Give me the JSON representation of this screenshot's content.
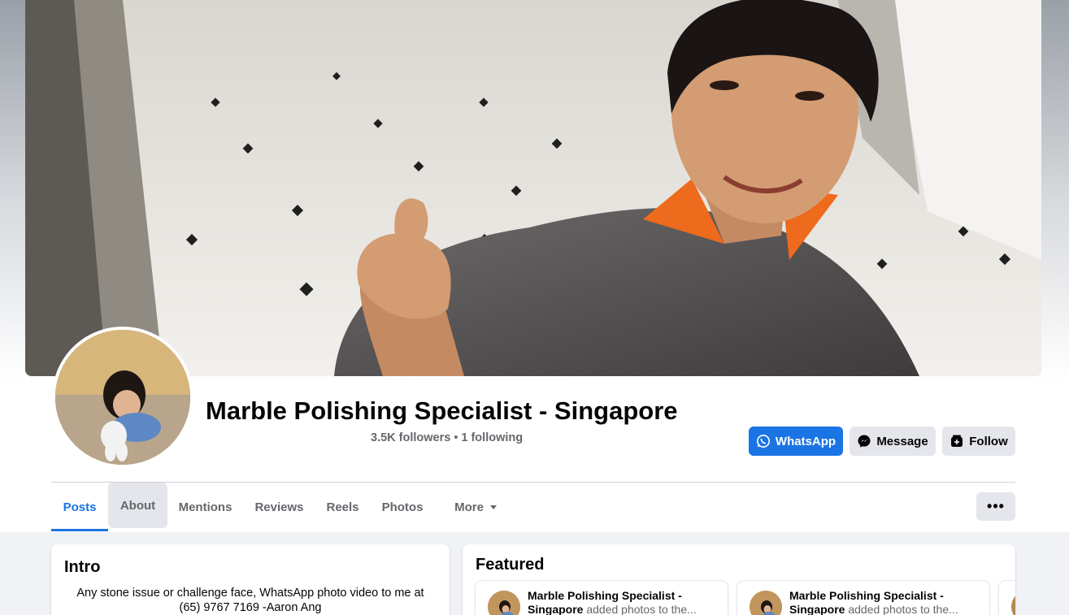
{
  "page": {
    "name": "Marble Polishing Specialist - Singapore",
    "followers": "3.5K followers",
    "separator": "•",
    "following": "1 following"
  },
  "actions": {
    "whatsapp_label": "WhatsApp",
    "message_label": "Message",
    "follow_label": "Follow",
    "more_options_label": "•••"
  },
  "tabs": [
    {
      "label": "Posts",
      "active": true
    },
    {
      "label": "About",
      "active": false
    },
    {
      "label": "Mentions",
      "active": false
    },
    {
      "label": "Reviews",
      "active": false
    },
    {
      "label": "Reels",
      "active": false
    },
    {
      "label": "Photos",
      "active": false
    },
    {
      "label": "More",
      "active": false
    }
  ],
  "intro": {
    "title": "Intro",
    "text_line1": "Any stone issue or challenge face, WhatsApp photo video to me at",
    "text_line2": "(65) 9767 7169 -Aaron Ang"
  },
  "featured": {
    "title": "Featured",
    "items": [
      {
        "author": "Marble Polishing Specialist - Singapore",
        "action": "added photos to the..."
      },
      {
        "author": "Marble Polishing Specialist - Singapore",
        "action": "added photos to the..."
      }
    ]
  },
  "colors": {
    "accent": "#1b74e4",
    "button_gray": "#e4e6eb",
    "secondary_text": "#65676b",
    "page_bg": "#f0f2f5"
  },
  "icons": {
    "whatsapp": "whatsapp-icon",
    "message": "messenger-icon",
    "follow": "follow-icon",
    "more_caret": "caret-down-icon"
  }
}
